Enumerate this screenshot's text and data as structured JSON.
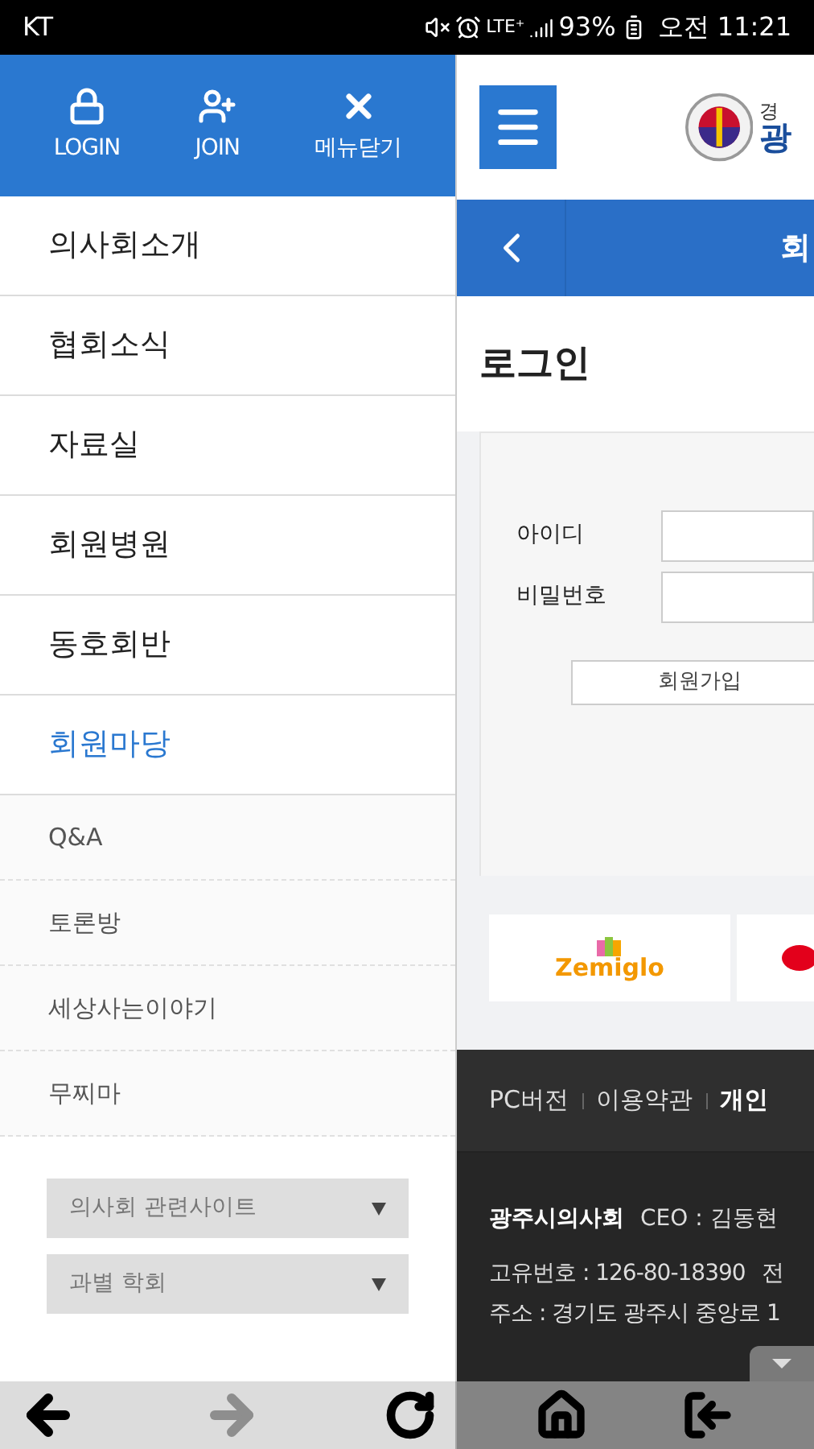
{
  "status_bar": {
    "carrier": "KT",
    "network": "LTE⁺",
    "battery": "93%",
    "time": "오전 11:21"
  },
  "drawer": {
    "header_buttons": [
      {
        "kind": "lock",
        "label": "LOGIN"
      },
      {
        "kind": "join",
        "label": "JOIN"
      },
      {
        "kind": "close",
        "label": "메뉴닫기"
      }
    ],
    "menu": [
      {
        "label": "의사회소개",
        "selected": false
      },
      {
        "label": "협회소식",
        "selected": false
      },
      {
        "label": "자료실",
        "selected": false
      },
      {
        "label": "회원병원",
        "selected": false
      },
      {
        "label": "동호회반",
        "selected": false
      },
      {
        "label": "회원마당",
        "selected": true,
        "children": [
          {
            "label": "Q&A"
          },
          {
            "label": "토론방"
          },
          {
            "label": "세상사는이야기"
          },
          {
            "label": "무찌마"
          }
        ]
      }
    ],
    "selects": [
      {
        "value": "의사회 관련사이트"
      },
      {
        "value": "과별 학회"
      }
    ]
  },
  "page": {
    "logo_text": [
      "경",
      "광"
    ],
    "sub_header": "회",
    "heading": "로그인",
    "form": {
      "fields": [
        {
          "label": "아이디"
        },
        {
          "label": "비밀번호"
        }
      ],
      "join_button": "회원가입"
    },
    "banners": [
      {
        "kind": "zemiglo",
        "text": "Zemiglo"
      },
      {
        "kind": "red-oval"
      }
    ],
    "footer": {
      "links": [
        {
          "label": "PC버전",
          "bold": false
        },
        {
          "label": "이용약관",
          "bold": false
        },
        {
          "label": "개인",
          "bold": true
        }
      ],
      "org": "광주시의사회",
      "ceo": "CEO : 김동현",
      "reg": "고유번호 : 126-80-18390",
      "reg_next": "전",
      "address": "주소 : 경기도 광주시 중앙로 1"
    }
  },
  "browser_nav": [
    {
      "kind": "back",
      "disabled": false
    },
    {
      "kind": "forward",
      "disabled": true
    },
    {
      "kind": "reload",
      "disabled": false
    }
  ],
  "overlay_nav": [
    {
      "kind": "home"
    },
    {
      "kind": "exit"
    }
  ]
}
